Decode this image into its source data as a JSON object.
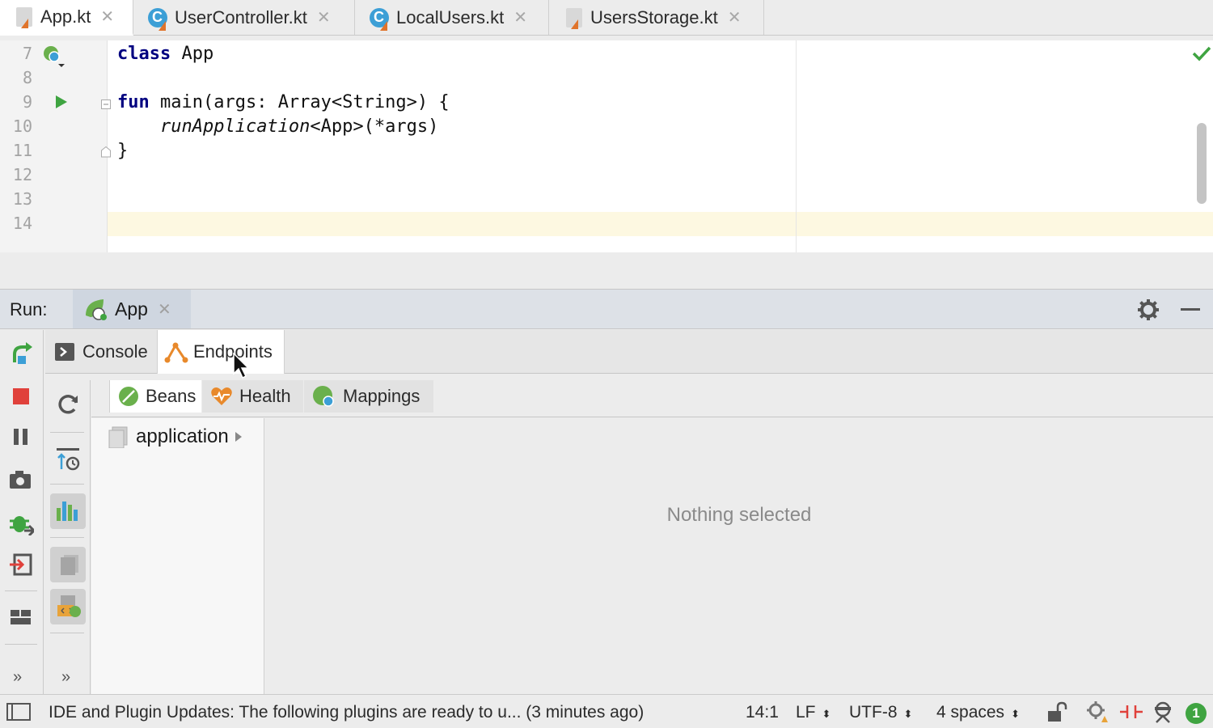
{
  "editor_tabs": [
    {
      "label": "App.kt",
      "type": "kotlin-file-icon",
      "active": true
    },
    {
      "label": "UserController.kt",
      "type": "kotlin-class-icon",
      "active": false
    },
    {
      "label": "LocalUsers.kt",
      "type": "kotlin-class-icon",
      "active": false
    },
    {
      "label": "UsersStorage.kt",
      "type": "kotlin-file-icon",
      "active": false
    }
  ],
  "editor": {
    "line_numbers": [
      "7",
      "8",
      "9",
      "10",
      "11",
      "12",
      "13",
      "14"
    ],
    "code": {
      "l7_kw": "class",
      "l7_rest": " App",
      "l9_kw": "fun",
      "l9_rest": " main(args: Array<String>) {",
      "l10_italic": "runApplication",
      "l10_rest": "<App>(*args)",
      "l11": "}"
    },
    "caret_line": 14
  },
  "run_panel": {
    "title": "Run:",
    "config_tab": "App",
    "subtabs": [
      "Console",
      "Endpoints"
    ],
    "active_subtab": "Endpoints",
    "endpoint_tabs": [
      "Beans",
      "Health",
      "Mappings"
    ],
    "active_endpoint_tab": "Beans",
    "tree_item": "application",
    "empty_text": "Nothing selected"
  },
  "status_bar": {
    "message": "IDE and Plugin Updates: The following plugins are ready to u... (3 minutes ago)",
    "position": "14:1",
    "line_separator": "LF",
    "encoding": "UTF-8",
    "indent": "4 spaces",
    "notifications_count": "1"
  },
  "colors": {
    "accent_green": "#3fa441",
    "stop_red": "#e0413b",
    "kotlin_orange": "#e0742b",
    "keyword_blue": "#000080"
  }
}
